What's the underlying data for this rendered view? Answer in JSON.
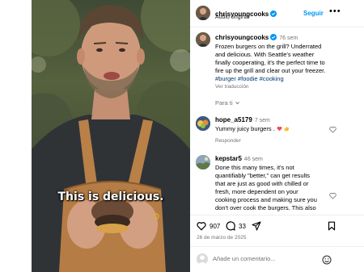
{
  "video": {
    "caption": "This is delicious."
  },
  "post": {
    "username": "chrisyoungcooks",
    "audio": "Audio original",
    "follow_label": "Seguir",
    "more_label": "•••"
  },
  "caption_comment": {
    "username": "chrisyoungcooks",
    "time": "76 sem",
    "lines": [
      "Frozen burgers on the grill? Underrated",
      "and delicious. With Seattle's weather",
      "finally cooperating, it's the perfect time to",
      "fire up the grill and clear out your freezer."
    ],
    "hashtags": "#burger #foodie #cooking",
    "translate_label": "Ver traducción",
    "for_you_label": "Para ti"
  },
  "comments": [
    {
      "username": "hope_a5179",
      "time": "7 sem",
      "text": "Yummy juicy burgers .",
      "reply_label": "Responder"
    },
    {
      "username": "kepstar5",
      "time": "46 sem",
      "lines": [
        "Done this many times, it's not",
        "quantifiably \"better,\" can get results",
        "that are just as good with chilled or",
        "fresh, more dependent on your",
        "cooking process and making sure you",
        "don't over cook the burgers. This also"
      ]
    }
  ],
  "actions": {
    "likes": "907",
    "comments": "33"
  },
  "date": "26 de marzo de 2025",
  "add_comment": {
    "placeholder": "Añade un comentario..."
  },
  "icons": [
    "verified-icon",
    "more-icon",
    "heart-icon",
    "comment-icon",
    "share-icon",
    "save-icon",
    "emoji-icon",
    "chevron-down-icon"
  ],
  "colors": {
    "accent": "#0095f6",
    "hashtag": "#00376b",
    "muted": "#737373",
    "heart": "#ed4956"
  }
}
